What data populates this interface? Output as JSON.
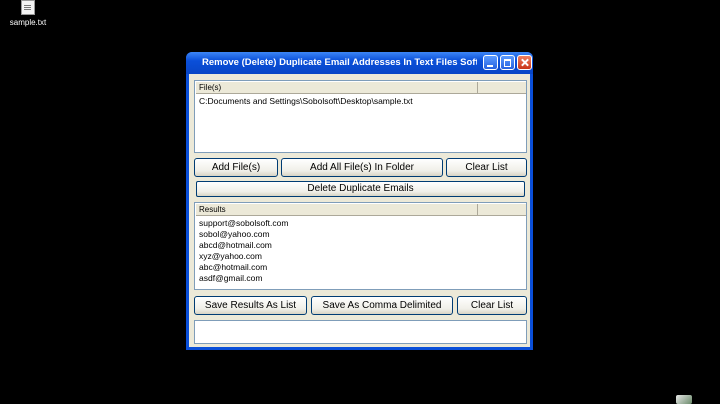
{
  "desktop": {
    "icon_label": "sample.txt"
  },
  "window": {
    "title": "Remove (Delete) Duplicate Email Addresses In Text Files Soft..."
  },
  "files_list": {
    "header": "File(s)",
    "items": [
      "C:Documents and Settings\\Sobolsoft\\Desktop\\sample.txt"
    ]
  },
  "buttons": {
    "add_files": "Add File(s)",
    "add_all_folder": "Add All File(s) In Folder",
    "clear_list_files": "Clear List",
    "delete_duplicates": "Delete Duplicate Emails",
    "save_as_list": "Save Results As List",
    "save_comma": "Save As Comma Delimited",
    "clear_list_results": "Clear List"
  },
  "results_list": {
    "header": "Results",
    "items": [
      "support@sobolsoft.com",
      "sobol@yahoo.com",
      "abcd@hotmail.com",
      "xyz@yahoo.com",
      "abc@hotmail.com",
      "asdf@gmail.com"
    ]
  }
}
